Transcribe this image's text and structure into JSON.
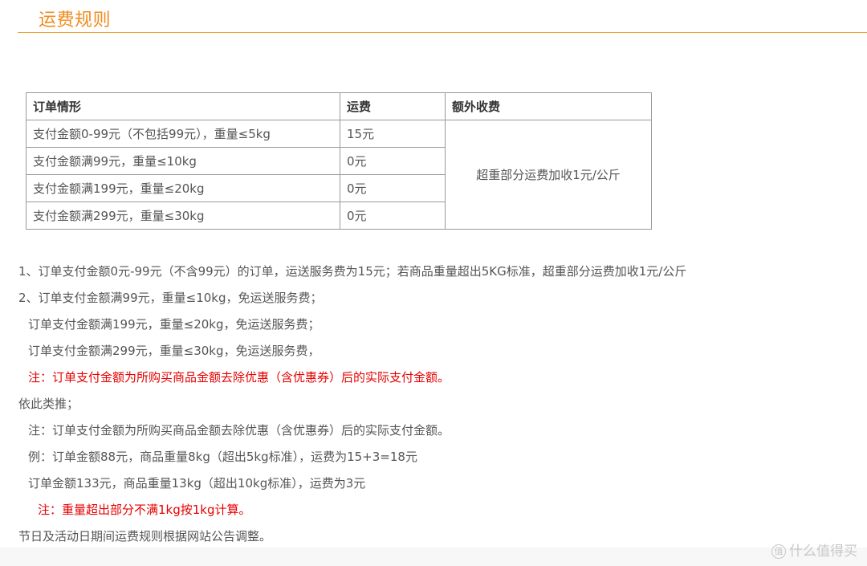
{
  "header": {
    "title": "运费规则"
  },
  "table": {
    "headers": [
      "订单情形",
      "运费",
      "额外收费"
    ],
    "rows": [
      {
        "condition": "支付金额0-99元（不包括99元），重量≤5kg",
        "fee": "15元"
      },
      {
        "condition": "支付金额满99元，重量≤10kg",
        "fee": "0元"
      },
      {
        "condition": "支付金额满199元，重量≤20kg",
        "fee": "0元"
      },
      {
        "condition": "支付金额满299元，重量≤30kg",
        "fee": "0元"
      }
    ],
    "extra_charge": "超重部分运费加收1元/公斤"
  },
  "notes": [
    "1、订单支付金额0元-99元（不含99元）的订单，运送服务费为15元；若商品重量超出5KG标准，超重部分运费加收1元/公斤",
    "2、订单支付金额满99元，重量≤10kg，免运送服务费；",
    "订单支付金额满199元，重量≤20kg，免运送服务费；",
    "订单支付金额满299元，重量≤30kg，免运送服务费，",
    "注：订单支付金额为所购买商品金额去除优惠（含优惠券）后的实际支付金额。",
    "依此类推；",
    "注：订单支付金额为所购买商品金额去除优惠（含优惠券）后的实际支付金额。",
    "例：订单金额88元，商品重量8kg（超出5kg标准），运费为15+3=18元",
    "订单金额133元，商品重量13kg（超出10kg标准），运费为3元",
    "注：重量超出部分不满1kg按1kg计算。",
    "节日及活动日期间运费规则根据网站公告调整。"
  ],
  "colors": {
    "accent": "#f08c1e",
    "warning": "#e60000",
    "text": "#555555"
  },
  "watermark": {
    "icon": "值",
    "text": "什么值得买"
  }
}
